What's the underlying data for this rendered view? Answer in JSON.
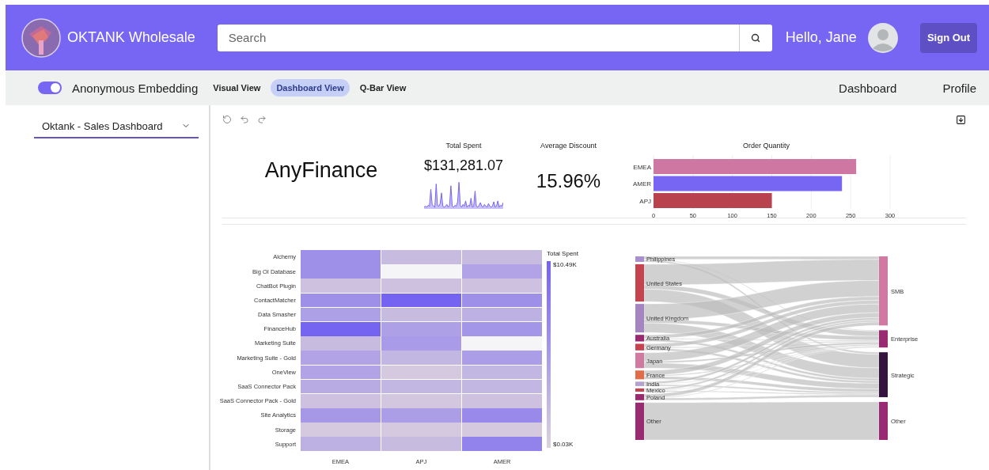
{
  "header": {
    "brand": "OKTANK Wholesale",
    "search": {
      "placeholder": "Search"
    },
    "greeting": "Hello, Jane",
    "sign_out": "Sign Out"
  },
  "nav": {
    "toggle": {
      "label": "Anonymous Embedding",
      "on": true
    },
    "views": [
      {
        "label": "Visual View",
        "selected": false
      },
      {
        "label": "Dashboard View",
        "selected": true
      },
      {
        "label": "Q-Bar View",
        "selected": false
      }
    ],
    "links": [
      "Dashboard",
      "Profile"
    ]
  },
  "sidebar": {
    "dashboard_select": {
      "value": "Oktank - Sales Dashboard"
    }
  },
  "dashboard": {
    "title_visual": "AnyFinance",
    "total_spent": {
      "title": "Total Spent",
      "value": "$131,281.07"
    },
    "average_discount": {
      "title": "Average Discount",
      "value": "15.96%"
    },
    "order_quantity": {
      "chart_data": {
        "type": "bar",
        "title": "Order Quantity",
        "orientation": "horizontal",
        "categories": [
          "EMEA",
          "AMER",
          "APJ"
        ],
        "values": [
          257,
          239,
          150
        ],
        "colors": [
          "#cf77a3",
          "#7765f3",
          "#b9424f"
        ],
        "xlim": [
          0,
          300
        ],
        "grid": true,
        "xticks": [
          0,
          50,
          100,
          150,
          200,
          250,
          300
        ]
      }
    },
    "heatmap": {
      "columns": [
        "EMEA",
        "APJ",
        "AMER"
      ],
      "legend": {
        "title": "Total Spent",
        "max": "$10.49K",
        "min": "$0.03K"
      },
      "rows": [
        "Alchemy",
        "Big OI Database",
        "ChatBot Plugin",
        "ContactMatcher",
        "Data Smasher",
        "FinanceHub",
        "Marketing Suite",
        "Marketing Suite - Gold",
        "OneView",
        "SaaS Connector Pack",
        "SaaS Connector Pack - Gold",
        "Site Analytics",
        "Storage",
        "Support"
      ]
    },
    "sankey": {
      "sources": [
        {
          "label": "Philippines",
          "color": "#a98fcf"
        },
        {
          "label": "United States",
          "color": "#c4434f"
        },
        {
          "label": "United Kingdom",
          "color": "#a585c0"
        },
        {
          "label": "Australia",
          "color": "#9a2a6f"
        },
        {
          "label": "Germany",
          "color": "#c4434e"
        },
        {
          "label": "Japan",
          "color": "#d07aa2"
        },
        {
          "label": "France",
          "color": "#e06c4a"
        },
        {
          "label": "India",
          "color": "#b3a3cc"
        },
        {
          "label": "Mexico",
          "color": "#c44350"
        },
        {
          "label": "Poland",
          "color": "#9a2a70"
        },
        {
          "label": "Other",
          "color": "#9a2a71"
        }
      ],
      "targets": [
        {
          "label": "SMB",
          "color": "#d07aa3"
        },
        {
          "label": "Enterprise",
          "color": "#9a2a72"
        },
        {
          "label": "Strategic",
          "color": "#35143f"
        },
        {
          "label": "Other",
          "color": "#9a2a73"
        }
      ]
    }
  }
}
